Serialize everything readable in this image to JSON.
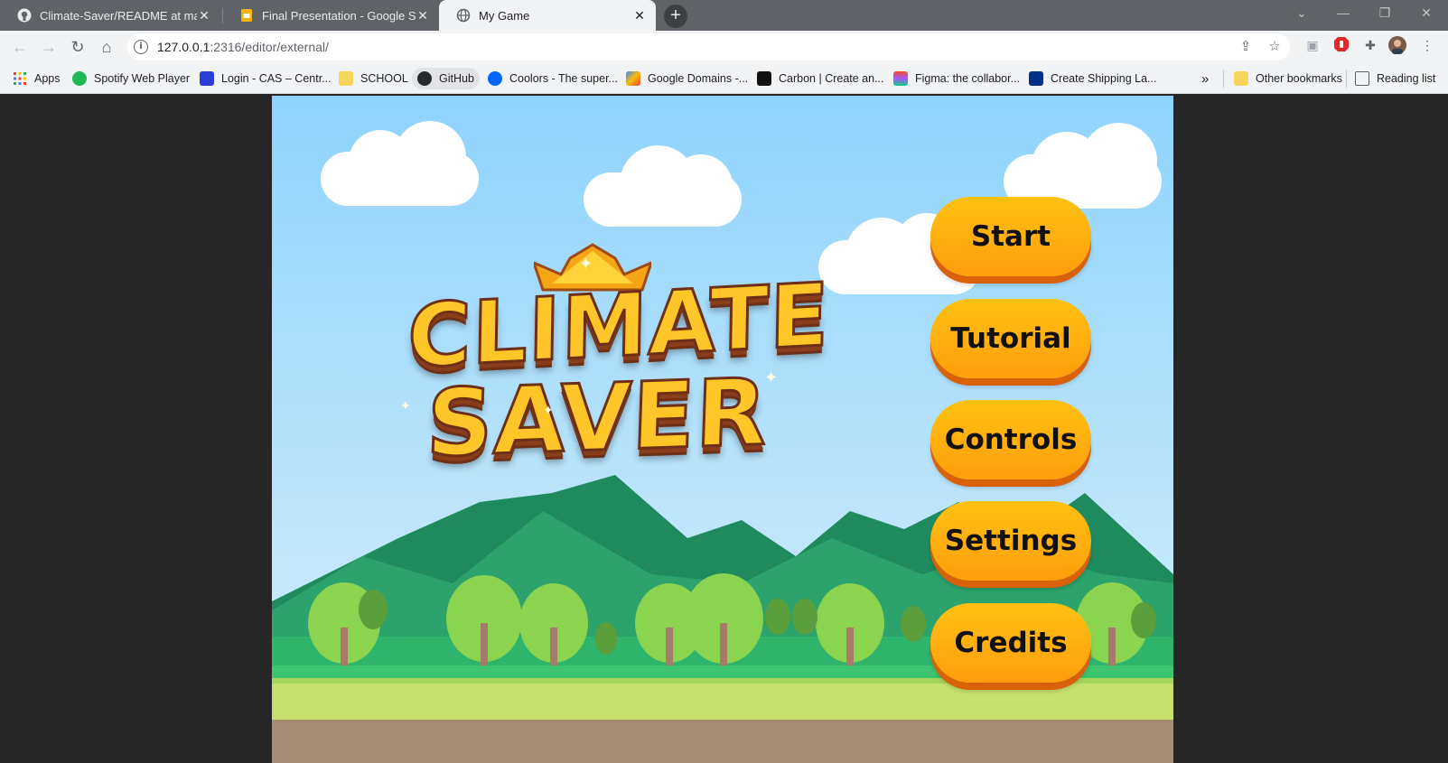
{
  "browser": {
    "tabs": [
      {
        "title": "Climate-Saver/README at main ·",
        "favicon": "github-icon",
        "active": false
      },
      {
        "title": "Final Presentation - Google Slides",
        "favicon": "google-slides-icon",
        "active": false
      },
      {
        "title": "My Game",
        "favicon": "globe-icon",
        "active": true
      }
    ],
    "new_tab_label": "+",
    "address": {
      "host": "127.0.0.1",
      "path": ":2316/editor/external/"
    },
    "bookmarks": [
      {
        "label": "Apps",
        "icon": "apps-grid-icon"
      },
      {
        "label": "Spotify Web Player",
        "icon": "spotify-icon",
        "color": "#1db954"
      },
      {
        "label": "Login - CAS – Centr...",
        "icon": "cas-icon",
        "color": "#2b3fd6"
      },
      {
        "label": "SCHOOL",
        "icon": "folder-icon",
        "color": "#f6d65a"
      },
      {
        "label": "GitHub",
        "icon": "github-icon",
        "color": "#24292e"
      },
      {
        "label": "Coolors - The super...",
        "icon": "coolors-icon",
        "color": "#0066ff"
      },
      {
        "label": "Google Domains -...",
        "icon": "google-domains-icon",
        "color": "#fbbc04"
      },
      {
        "label": "Carbon | Create an...",
        "icon": "carbon-icon",
        "color": "#111111"
      },
      {
        "label": "Figma: the collabor...",
        "icon": "figma-icon",
        "color": "#f24e1e"
      },
      {
        "label": "Create Shipping La...",
        "icon": "paypal-icon",
        "color": "#003087"
      }
    ],
    "overflow_label": "»",
    "other_bookmarks": "Other bookmarks",
    "reading_list": "Reading list"
  },
  "game": {
    "logo": {
      "line1": "CLIMATE",
      "line2": "SAVER"
    },
    "menu": [
      {
        "label": "Start"
      },
      {
        "label": "Tutorial"
      },
      {
        "label": "Controls"
      },
      {
        "label": "Settings"
      },
      {
        "label": "Credits"
      }
    ],
    "colors": {
      "button": "#ffb00f",
      "button_shadow": "#d9610a",
      "sky": "#8fd3fd",
      "logo": "#ffc629"
    }
  }
}
